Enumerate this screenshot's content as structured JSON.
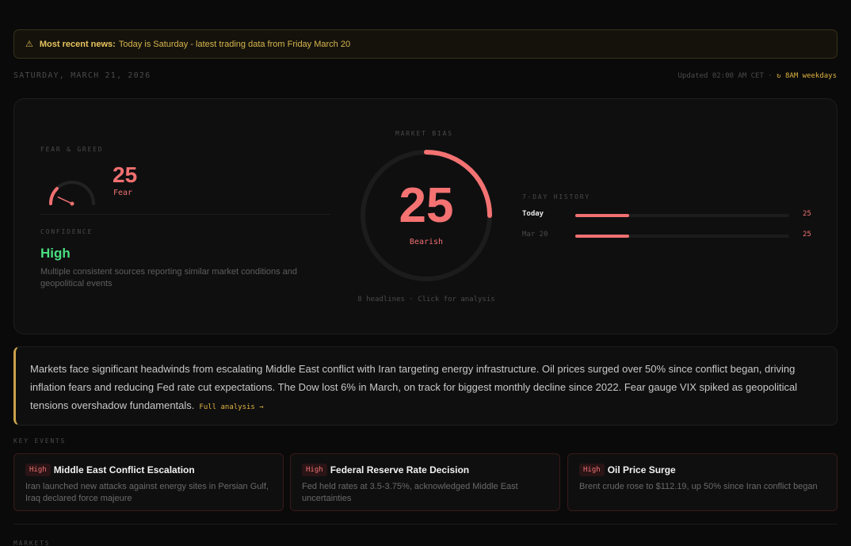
{
  "news": {
    "icon": "warning-icon",
    "prefix": "Most recent news:",
    "text": "Today is Saturday - latest trading data from Friday March 20"
  },
  "header": {
    "date": "SATURDAY, MARCH 21, 2026",
    "updated": "Updated 02:00 AM CET · ",
    "schedule": "↻ 8AM weekdays"
  },
  "fear_greed": {
    "label": "FEAR & GREED",
    "value": "25",
    "text": "Fear",
    "level": 25
  },
  "confidence": {
    "label": "CONFIDENCE",
    "value": "High",
    "description": "Multiple consistent sources reporting similar market conditions and geopolitical events"
  },
  "bias": {
    "label": "MARKET BIAS",
    "value": "25",
    "text": "Bearish",
    "level": 25,
    "footer": "8 headlines · Click for analysis"
  },
  "history": {
    "label": "7-DAY HISTORY",
    "rows": [
      {
        "name": "Today",
        "value": "25",
        "level": 25
      },
      {
        "name": "Mar 20",
        "value": "25",
        "level": 25
      }
    ]
  },
  "summary": {
    "text": "Markets face significant headwinds from escalating Middle East conflict with Iran targeting energy infrastructure. Oil prices surged over 50% since conflict began, driving inflation fears and reducing Fed rate cut expectations. The Dow lost 6% in March, on track for biggest monthly decline since 2022. Fear gauge VIX spiked as geopolitical tensions overshadow fundamentals.",
    "link": "Full analysis →"
  },
  "events": {
    "label": "KEY EVENTS",
    "items": [
      {
        "badge": "High",
        "title": "Middle East Conflict Escalation",
        "desc": "Iran launched new attacks against energy sites in Persian Gulf, Iraq declared force majeure"
      },
      {
        "badge": "High",
        "title": "Federal Reserve Rate Decision",
        "desc": "Fed held rates at 3.5-3.75%, acknowledged Middle East uncertainties"
      },
      {
        "badge": "High",
        "title": "Oil Price Surge",
        "desc": "Brent crude rose to $112.19, up 50% since Iran conflict began"
      }
    ]
  },
  "markets": {
    "label": "MARKETS"
  },
  "colors": {
    "fear": "#f07070",
    "confidence_high": "#4ade80",
    "accent": "#e0b440"
  }
}
